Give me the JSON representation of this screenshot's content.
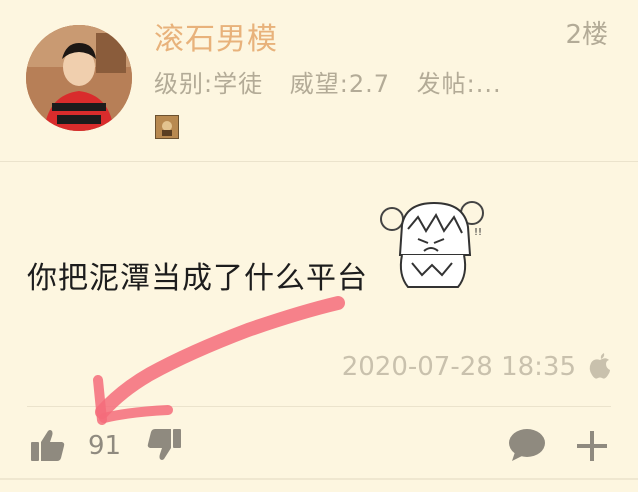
{
  "author": {
    "name": "滚石男模",
    "level_label": "级别:学徒",
    "prestige_label": "威望:2.7",
    "posts_label": "发帖:..."
  },
  "floor": "2楼",
  "content": {
    "text": "你把泥潭当成了什么平台"
  },
  "timestamp": "2020-07-28 18:35",
  "actions": {
    "like_count": "91"
  },
  "icons": {
    "like": "thumbs-up-icon",
    "dislike": "thumbs-down-icon",
    "reply": "speech-bubble-icon",
    "more": "plus-icon",
    "device": "apple-logo-icon"
  },
  "colors": {
    "background": "#fdf6e0",
    "author_name": "#e8b27b",
    "meta_text": "#b3ab97",
    "annotation_arrow": "#f46c7a"
  }
}
